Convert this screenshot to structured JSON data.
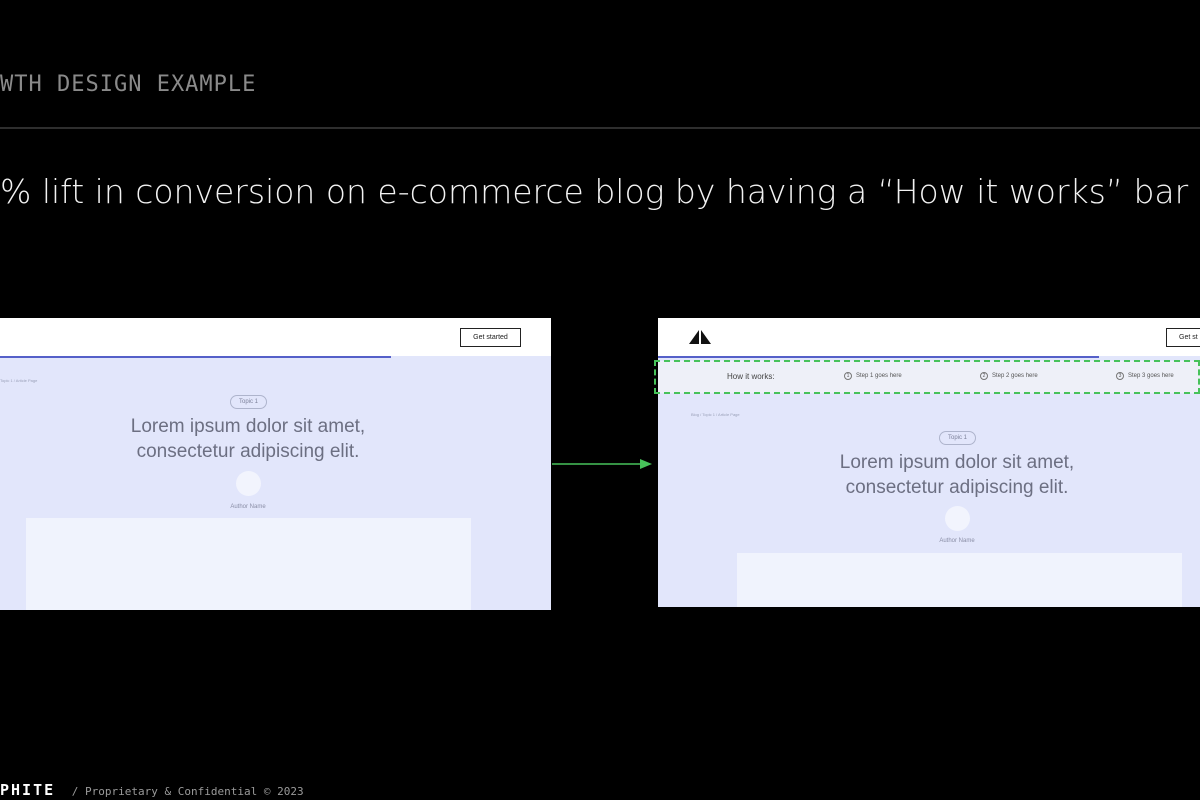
{
  "slide": {
    "eyebrow": "WTH DESIGN EXAMPLE",
    "headline": "% lift in conversion on e-commerce blog by having a “How it works” bar"
  },
  "before": {
    "cta_label": "Get started",
    "breadcrumb": "Topic 1 / Article Page",
    "topic": "Topic 1",
    "title_line1": "Lorem ipsum dolor sit amet,",
    "title_line2": "consectetur adipiscing elit.",
    "author": "Author Name"
  },
  "after": {
    "logo_icon": "triangle-logo-icon",
    "cta_label": "Get st",
    "how_it_works": {
      "label": "How it works:",
      "steps": [
        {
          "num": "1",
          "text": "Step 1 goes here"
        },
        {
          "num": "2",
          "text": "Step 2 goes here"
        },
        {
          "num": "3",
          "text": "Step 3 goes here"
        }
      ]
    },
    "breadcrumb": "Blog / Topic 1 / Article Page",
    "topic": "Topic 1",
    "title_line1": "Lorem ipsum dolor sit amet,",
    "title_line2": "consectetur adipiscing elit.",
    "author": "Author Name"
  },
  "colors": {
    "highlight": "#47c25a",
    "progress": "#5560c9",
    "screen_bg": "#e2e6fb"
  },
  "footer": {
    "brand": "PHITE",
    "text": "/ Proprietary & Confidential © 2023"
  }
}
